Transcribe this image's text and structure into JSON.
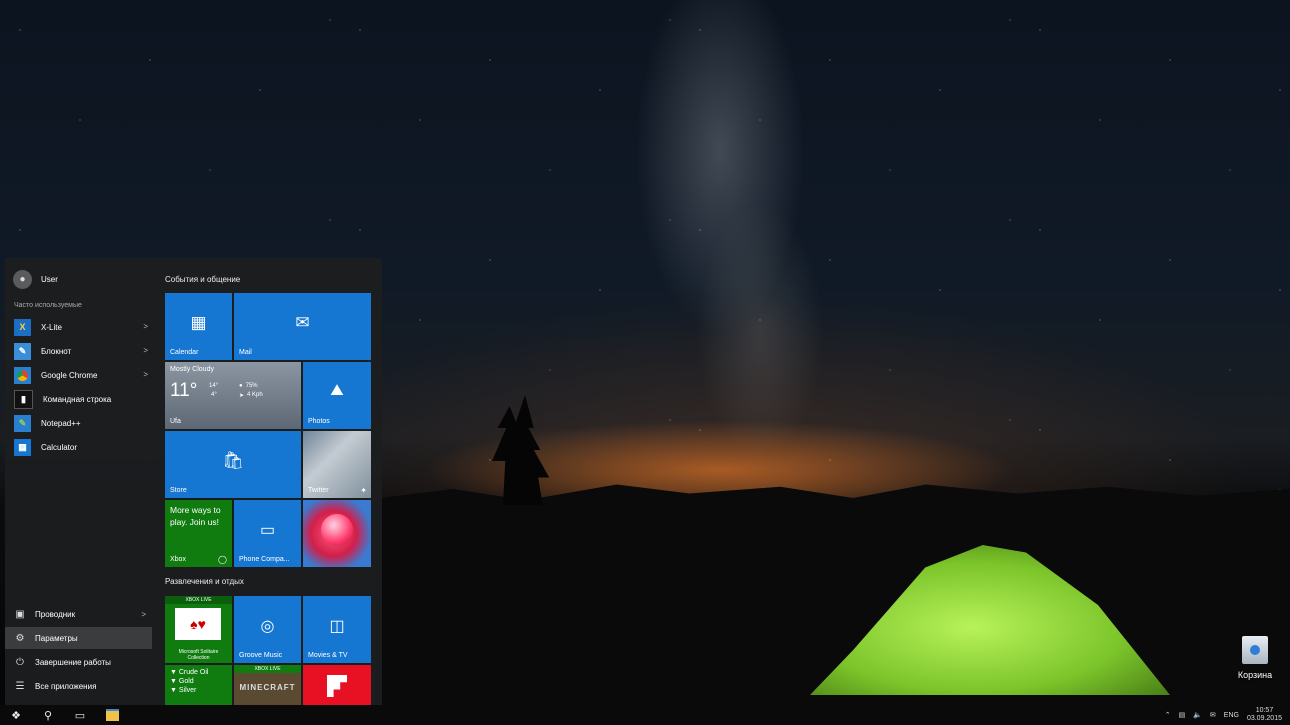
{
  "desktop": {
    "recycle_bin_label": "Корзина"
  },
  "start_menu": {
    "user": {
      "name": "User"
    },
    "frequent_header": "Часто используемые",
    "frequent_apps": [
      {
        "label": "X-Lite",
        "icon": "xlite-icon",
        "has_arrow": true
      },
      {
        "label": "Блокнот",
        "icon": "notepad-icon",
        "has_arrow": true
      },
      {
        "label": "Google Chrome",
        "icon": "chrome-icon",
        "has_arrow": true
      },
      {
        "label": "Командная строка",
        "icon": "cmd-icon",
        "has_arrow": false
      },
      {
        "label": "Notepad++",
        "icon": "notepadpp-icon",
        "has_arrow": false
      },
      {
        "label": "Calculator",
        "icon": "calculator-icon",
        "has_arrow": false
      }
    ],
    "bottom": {
      "explorer": "Проводник",
      "settings": "Параметры",
      "shutdown": "Завершение работы",
      "all_apps": "Все приложения"
    },
    "groups": {
      "events": "События и общение",
      "entertainment": "Развлечения и отдых"
    },
    "tiles": {
      "calendar": "Calendar",
      "mail": "Mail",
      "weather": {
        "condition": "Mostly Cloudy",
        "temp": "11°",
        "high": "14°",
        "low": "4°",
        "humidity": "75%",
        "wind": "4 Kph",
        "city": "Ufa"
      },
      "photos": "Photos",
      "store": "Store",
      "twitter": "Twitter",
      "xbox": {
        "text": "More ways to play. Join us!",
        "label": "Xbox"
      },
      "phone": "Phone Compa...",
      "solitaire": {
        "badge": "XBOX LIVE",
        "label": "Microsoft Solitaire Collection"
      },
      "groove": "Groove Music",
      "movies": "Movies & TV",
      "commodities": {
        "lines": [
          "▼ Crude Oil",
          "▼ Gold",
          "▼ Silver"
        ]
      },
      "minecraft": {
        "badge": "XBOX LIVE",
        "label": "MINECRAFT"
      }
    }
  },
  "taskbar": {
    "language": "ENG",
    "time": "10:57",
    "date": "03.09.2015"
  },
  "colors": {
    "accent": "#1677d2",
    "xbox_green": "#107c10",
    "menu_bg": "#1c1d1f"
  }
}
